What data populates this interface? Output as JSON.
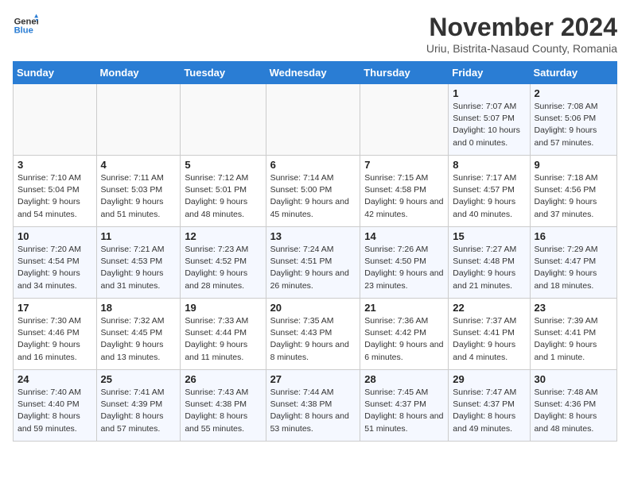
{
  "logo": {
    "line1": "General",
    "line2": "Blue"
  },
  "title": "November 2024",
  "subtitle": "Uriu, Bistrita-Nasaud County, Romania",
  "weekdays": [
    "Sunday",
    "Monday",
    "Tuesday",
    "Wednesday",
    "Thursday",
    "Friday",
    "Saturday"
  ],
  "weeks": [
    [
      {
        "day": "",
        "detail": ""
      },
      {
        "day": "",
        "detail": ""
      },
      {
        "day": "",
        "detail": ""
      },
      {
        "day": "",
        "detail": ""
      },
      {
        "day": "",
        "detail": ""
      },
      {
        "day": "1",
        "detail": "Sunrise: 7:07 AM\nSunset: 5:07 PM\nDaylight: 10 hours and 0 minutes."
      },
      {
        "day": "2",
        "detail": "Sunrise: 7:08 AM\nSunset: 5:06 PM\nDaylight: 9 hours and 57 minutes."
      }
    ],
    [
      {
        "day": "3",
        "detail": "Sunrise: 7:10 AM\nSunset: 5:04 PM\nDaylight: 9 hours and 54 minutes."
      },
      {
        "day": "4",
        "detail": "Sunrise: 7:11 AM\nSunset: 5:03 PM\nDaylight: 9 hours and 51 minutes."
      },
      {
        "day": "5",
        "detail": "Sunrise: 7:12 AM\nSunset: 5:01 PM\nDaylight: 9 hours and 48 minutes."
      },
      {
        "day": "6",
        "detail": "Sunrise: 7:14 AM\nSunset: 5:00 PM\nDaylight: 9 hours and 45 minutes."
      },
      {
        "day": "7",
        "detail": "Sunrise: 7:15 AM\nSunset: 4:58 PM\nDaylight: 9 hours and 42 minutes."
      },
      {
        "day": "8",
        "detail": "Sunrise: 7:17 AM\nSunset: 4:57 PM\nDaylight: 9 hours and 40 minutes."
      },
      {
        "day": "9",
        "detail": "Sunrise: 7:18 AM\nSunset: 4:56 PM\nDaylight: 9 hours and 37 minutes."
      }
    ],
    [
      {
        "day": "10",
        "detail": "Sunrise: 7:20 AM\nSunset: 4:54 PM\nDaylight: 9 hours and 34 minutes."
      },
      {
        "day": "11",
        "detail": "Sunrise: 7:21 AM\nSunset: 4:53 PM\nDaylight: 9 hours and 31 minutes."
      },
      {
        "day": "12",
        "detail": "Sunrise: 7:23 AM\nSunset: 4:52 PM\nDaylight: 9 hours and 28 minutes."
      },
      {
        "day": "13",
        "detail": "Sunrise: 7:24 AM\nSunset: 4:51 PM\nDaylight: 9 hours and 26 minutes."
      },
      {
        "day": "14",
        "detail": "Sunrise: 7:26 AM\nSunset: 4:50 PM\nDaylight: 9 hours and 23 minutes."
      },
      {
        "day": "15",
        "detail": "Sunrise: 7:27 AM\nSunset: 4:48 PM\nDaylight: 9 hours and 21 minutes."
      },
      {
        "day": "16",
        "detail": "Sunrise: 7:29 AM\nSunset: 4:47 PM\nDaylight: 9 hours and 18 minutes."
      }
    ],
    [
      {
        "day": "17",
        "detail": "Sunrise: 7:30 AM\nSunset: 4:46 PM\nDaylight: 9 hours and 16 minutes."
      },
      {
        "day": "18",
        "detail": "Sunrise: 7:32 AM\nSunset: 4:45 PM\nDaylight: 9 hours and 13 minutes."
      },
      {
        "day": "19",
        "detail": "Sunrise: 7:33 AM\nSunset: 4:44 PM\nDaylight: 9 hours and 11 minutes."
      },
      {
        "day": "20",
        "detail": "Sunrise: 7:35 AM\nSunset: 4:43 PM\nDaylight: 9 hours and 8 minutes."
      },
      {
        "day": "21",
        "detail": "Sunrise: 7:36 AM\nSunset: 4:42 PM\nDaylight: 9 hours and 6 minutes."
      },
      {
        "day": "22",
        "detail": "Sunrise: 7:37 AM\nSunset: 4:41 PM\nDaylight: 9 hours and 4 minutes."
      },
      {
        "day": "23",
        "detail": "Sunrise: 7:39 AM\nSunset: 4:41 PM\nDaylight: 9 hours and 1 minute."
      }
    ],
    [
      {
        "day": "24",
        "detail": "Sunrise: 7:40 AM\nSunset: 4:40 PM\nDaylight: 8 hours and 59 minutes."
      },
      {
        "day": "25",
        "detail": "Sunrise: 7:41 AM\nSunset: 4:39 PM\nDaylight: 8 hours and 57 minutes."
      },
      {
        "day": "26",
        "detail": "Sunrise: 7:43 AM\nSunset: 4:38 PM\nDaylight: 8 hours and 55 minutes."
      },
      {
        "day": "27",
        "detail": "Sunrise: 7:44 AM\nSunset: 4:38 PM\nDaylight: 8 hours and 53 minutes."
      },
      {
        "day": "28",
        "detail": "Sunrise: 7:45 AM\nSunset: 4:37 PM\nDaylight: 8 hours and 51 minutes."
      },
      {
        "day": "29",
        "detail": "Sunrise: 7:47 AM\nSunset: 4:37 PM\nDaylight: 8 hours and 49 minutes."
      },
      {
        "day": "30",
        "detail": "Sunrise: 7:48 AM\nSunset: 4:36 PM\nDaylight: 8 hours and 48 minutes."
      }
    ]
  ]
}
